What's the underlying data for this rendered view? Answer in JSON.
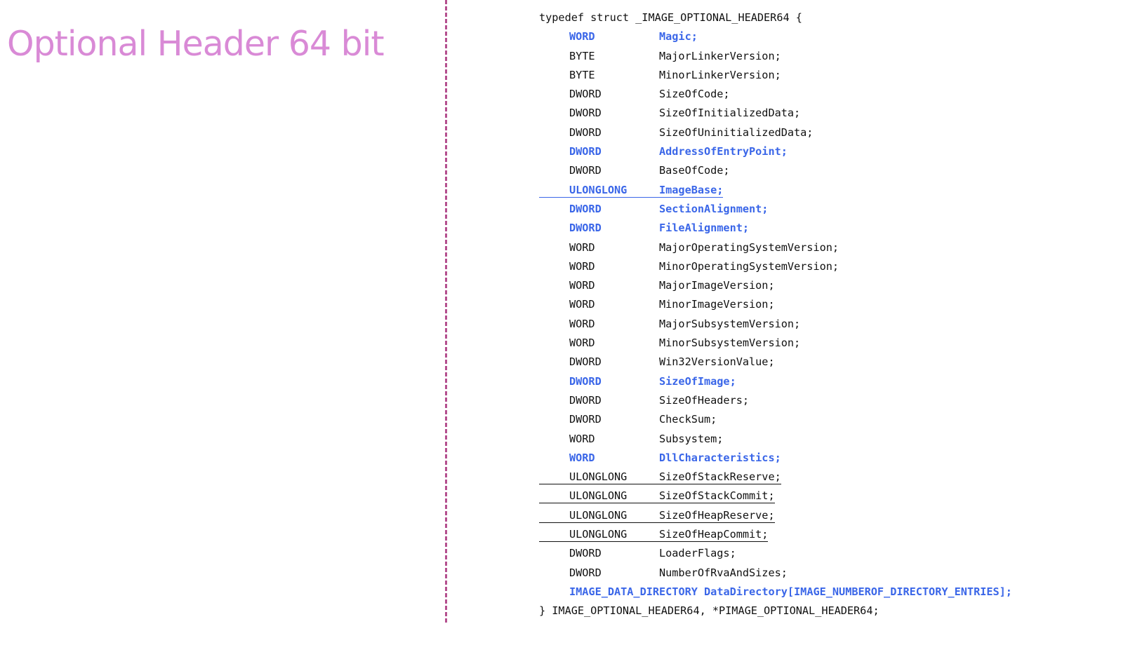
{
  "title": "Optional Header 64 bit",
  "colors": {
    "title": "#d98ad6",
    "divider": "#b5508f",
    "highlight": "#3a66e8",
    "code_text": "#111111"
  },
  "code": {
    "opening": "typedef struct _IMAGE_OPTIONAL_HEADER64 {",
    "members": [
      {
        "type": "WORD",
        "name": "Magic;",
        "highlight": true,
        "underline": false
      },
      {
        "type": "BYTE",
        "name": "MajorLinkerVersion;",
        "highlight": false,
        "underline": false
      },
      {
        "type": "BYTE",
        "name": "MinorLinkerVersion;",
        "highlight": false,
        "underline": false
      },
      {
        "type": "DWORD",
        "name": "SizeOfCode;",
        "highlight": false,
        "underline": false
      },
      {
        "type": "DWORD",
        "name": "SizeOfInitializedData;",
        "highlight": false,
        "underline": false
      },
      {
        "type": "DWORD",
        "name": "SizeOfUninitializedData;",
        "highlight": false,
        "underline": false
      },
      {
        "type": "DWORD",
        "name": "AddressOfEntryPoint;",
        "highlight": true,
        "underline": false
      },
      {
        "type": "DWORD",
        "name": "BaseOfCode;",
        "highlight": false,
        "underline": false
      },
      {
        "type": "ULONGLONG",
        "name": "ImageBase;",
        "highlight": true,
        "underline": true
      },
      {
        "type": "DWORD",
        "name": "SectionAlignment;",
        "highlight": true,
        "underline": false
      },
      {
        "type": "DWORD",
        "name": "FileAlignment;",
        "highlight": true,
        "underline": false
      },
      {
        "type": "WORD",
        "name": "MajorOperatingSystemVersion;",
        "highlight": false,
        "underline": false
      },
      {
        "type": "WORD",
        "name": "MinorOperatingSystemVersion;",
        "highlight": false,
        "underline": false
      },
      {
        "type": "WORD",
        "name": "MajorImageVersion;",
        "highlight": false,
        "underline": false
      },
      {
        "type": "WORD",
        "name": "MinorImageVersion;",
        "highlight": false,
        "underline": false
      },
      {
        "type": "WORD",
        "name": "MajorSubsystemVersion;",
        "highlight": false,
        "underline": false
      },
      {
        "type": "WORD",
        "name": "MinorSubsystemVersion;",
        "highlight": false,
        "underline": false
      },
      {
        "type": "DWORD",
        "name": "Win32VersionValue;",
        "highlight": false,
        "underline": false
      },
      {
        "type": "DWORD",
        "name": "SizeOfImage;",
        "highlight": true,
        "underline": false
      },
      {
        "type": "DWORD",
        "name": "SizeOfHeaders;",
        "highlight": false,
        "underline": false
      },
      {
        "type": "DWORD",
        "name": "CheckSum;",
        "highlight": false,
        "underline": false
      },
      {
        "type": "WORD",
        "name": "Subsystem;",
        "highlight": false,
        "underline": false
      },
      {
        "type": "WORD",
        "name": "DllCharacteristics;",
        "highlight": true,
        "underline": false
      },
      {
        "type": "ULONGLONG",
        "name": "SizeOfStackReserve;",
        "highlight": false,
        "underline": true
      },
      {
        "type": "ULONGLONG",
        "name": "SizeOfStackCommit;",
        "highlight": false,
        "underline": true
      },
      {
        "type": "ULONGLONG",
        "name": "SizeOfHeapReserve;",
        "highlight": false,
        "underline": true
      },
      {
        "type": "ULONGLONG",
        "name": "SizeOfHeapCommit;",
        "highlight": false,
        "underline": true
      },
      {
        "type": "DWORD",
        "name": "LoaderFlags;",
        "highlight": false,
        "underline": false
      },
      {
        "type": "DWORD",
        "name": "NumberOfRvaAndSizes;",
        "highlight": false,
        "underline": false
      },
      {
        "type": "IMAGE_DATA_DIRECTORY",
        "name": "DataDirectory[IMAGE_NUMBEROF_DIRECTORY_ENTRIES];",
        "highlight": true,
        "underline": false,
        "inline": true
      }
    ],
    "closing": "} IMAGE_OPTIONAL_HEADER64, *PIMAGE_OPTIONAL_HEADER64;"
  }
}
